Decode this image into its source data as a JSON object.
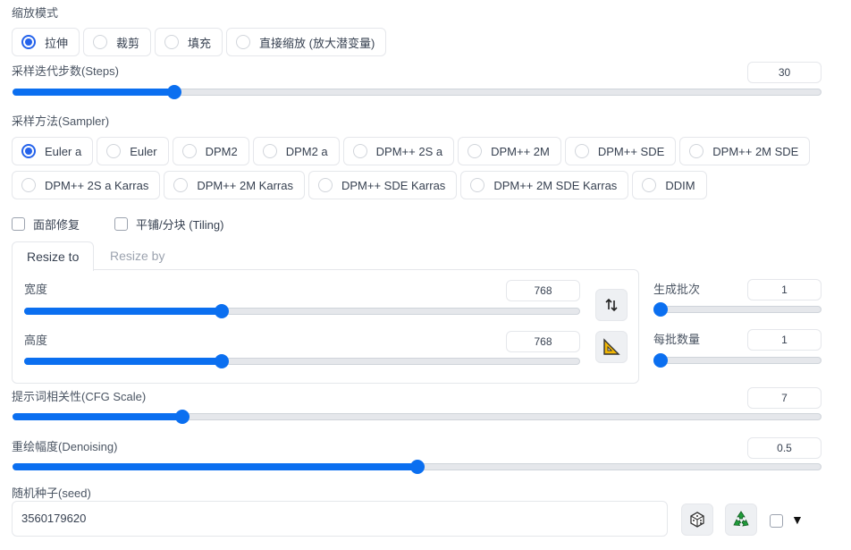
{
  "resize_mode": {
    "label": "缩放模式",
    "options": [
      "拉伸",
      "裁剪",
      "填充",
      "直接缩放 (放大潜变量)"
    ],
    "selected": "拉伸"
  },
  "steps": {
    "label": "采样迭代步数(Steps)",
    "value": "30",
    "fraction": 0.2
  },
  "sampler": {
    "label": "采样方法(Sampler)",
    "row1": [
      "Euler a",
      "Euler",
      "DPM2",
      "DPM2 a",
      "DPM++ 2S a",
      "DPM++ 2M",
      "DPM++ SDE",
      "DPM++ 2M SDE"
    ],
    "row2": [
      "DPM++ 2S a Karras",
      "DPM++ 2M Karras",
      "DPM++ SDE Karras",
      "DPM++ 2M SDE Karras",
      "DDIM"
    ],
    "selected": "Euler a"
  },
  "options": {
    "face_restore": "面部修复",
    "tiling": "平铺/分块 (Tiling)"
  },
  "tabs": {
    "resize_to": "Resize to",
    "resize_by": "Resize by"
  },
  "width": {
    "label": "宽度",
    "value": "768",
    "fraction": 0.355
  },
  "height": {
    "label": "高度",
    "value": "768",
    "fraction": 0.355
  },
  "batch_count": {
    "label": "生成批次",
    "value": "1",
    "fraction": 0.0
  },
  "batch_size": {
    "label": "每批数量",
    "value": "1",
    "fraction": 0.0
  },
  "cfg": {
    "label": "提示词相关性(CFG Scale)",
    "value": "7",
    "fraction": 0.21
  },
  "denoising": {
    "label": "重绘幅度(Denoising)",
    "value": "0.5",
    "fraction": 0.5
  },
  "seed": {
    "label": "随机种子(seed)",
    "value": "3560179620"
  },
  "icons": {
    "swap": "swap-dimensions-icon",
    "ruler": "triangle-ruler-icon",
    "dice": "dice-icon",
    "recycle": "recycle-icon",
    "expand": "triangle-down-icon"
  },
  "colors": {
    "accent": "#0b6ff0",
    "radio_selected": "#2563eb",
    "recycle_green": "#1f9d3a"
  }
}
